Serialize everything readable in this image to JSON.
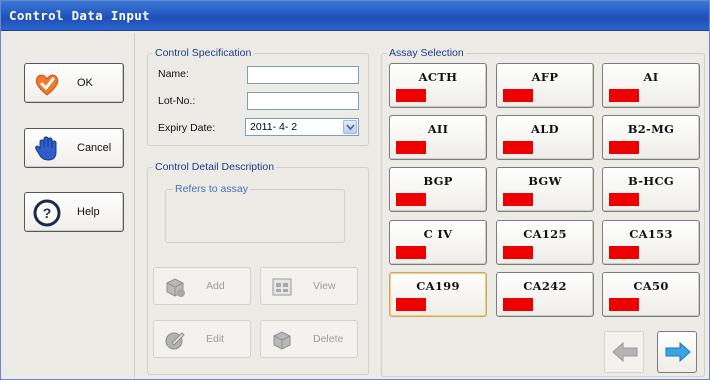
{
  "window": {
    "title": "Control Data Input"
  },
  "actions": {
    "ok": "OK",
    "cancel": "Cancel",
    "help": "Help"
  },
  "spec": {
    "title": "Control Specification",
    "name_label": "Name:",
    "name_value": "",
    "lot_label": "Lot-No.:",
    "lot_value": "",
    "expiry_label": "Expiry Date:",
    "expiry_value": "2011- 4- 2"
  },
  "detail": {
    "title": "Control Detail Description",
    "refers_title": "Refers to assay",
    "add": "Add",
    "view": "View",
    "edit": "Edit",
    "delete": "Delete"
  },
  "assay": {
    "title": "Assay Selection",
    "items": [
      "ACTH",
      "AFP",
      "AI",
      "AII",
      "ALD",
      "B2-MG",
      "BGP",
      "BGW",
      "B-HCG",
      "C IV",
      "CA125",
      "CA153",
      "CA199",
      "CA242",
      "CA50"
    ],
    "selected": "CA199",
    "flag_color": "#ee0000"
  }
}
